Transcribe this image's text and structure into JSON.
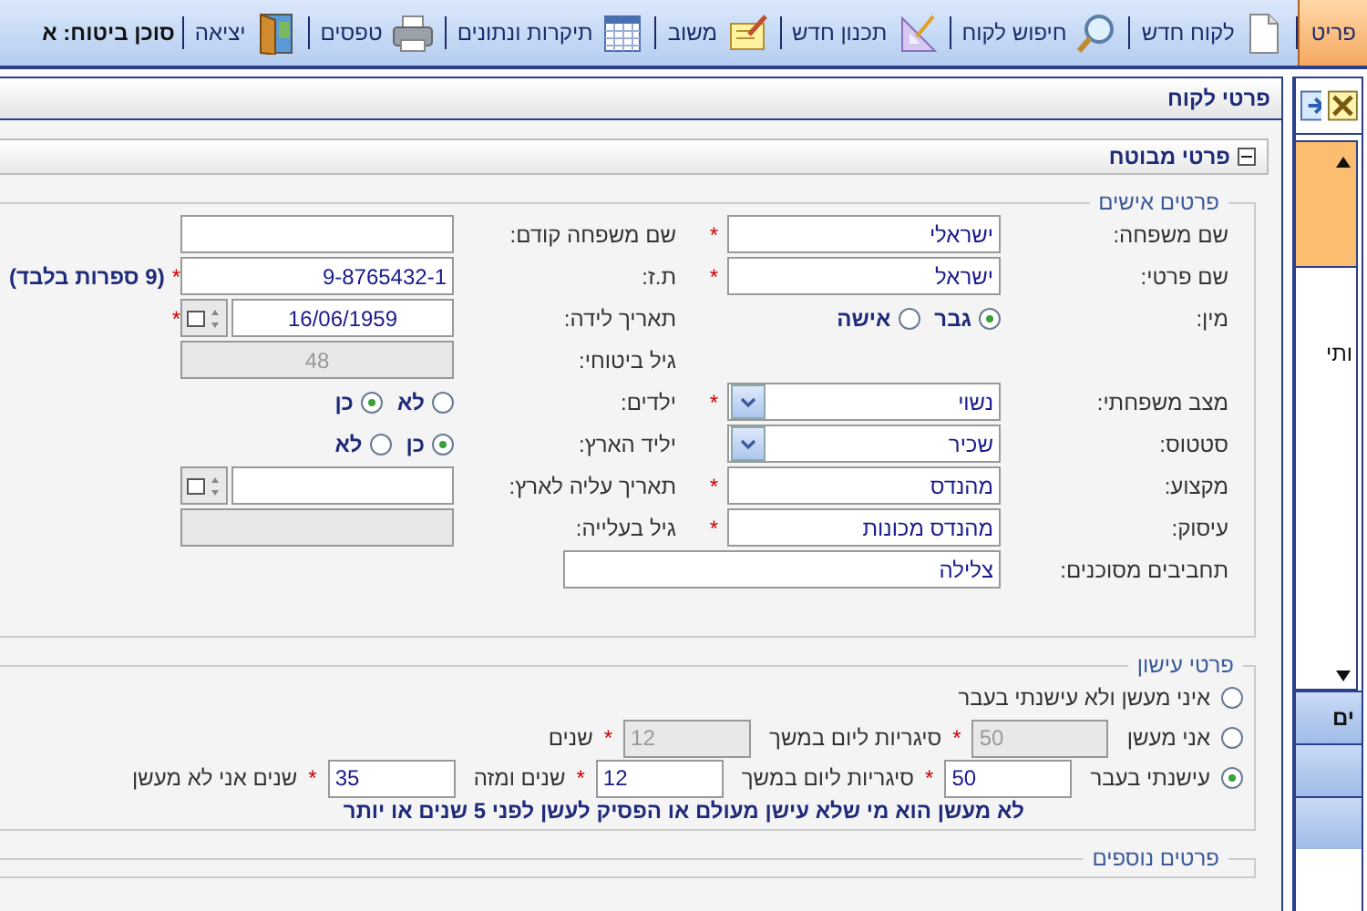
{
  "required_mark": "*",
  "toolbar": {
    "items": [
      {
        "label": "פריט",
        "selected": true
      },
      {
        "label": "לקוח חדש",
        "selected": false
      },
      {
        "label": "חיפוש לקוח",
        "selected": false
      },
      {
        "label": "תכנון חדש",
        "selected": false
      },
      {
        "label": "משוב",
        "selected": false
      },
      {
        "label": "תיקרות ונתונים",
        "selected": false
      },
      {
        "label": "טפסים",
        "selected": false
      },
      {
        "label": "יציאה",
        "selected": false
      }
    ],
    "agent_label": "סוכן ביטוח: א"
  },
  "panel": {
    "title": "פרטי לקוח",
    "section_title": "פרטי מבוטח",
    "section_expanded": true
  },
  "personal": {
    "legend": "פרטים אישים",
    "rows": [
      {
        "right": {
          "label": "שם משפחה:",
          "kind": "text",
          "value": "ישראלי",
          "required": true
        },
        "left": {
          "label": "שם משפחה קודם:",
          "kind": "text"
        }
      },
      {
        "right": {
          "label": "שם פרטי:",
          "kind": "text",
          "value": "ישראל",
          "required": true
        },
        "left": {
          "label": "ת.ז:",
          "kind": "text",
          "value": "9-8765432-1",
          "required": true,
          "note": "(9 ספרות בלבד)"
        }
      },
      {
        "right": {
          "label": "מין:",
          "kind": "radio",
          "options": [
            {
              "label": "גבר",
              "selected": true
            },
            {
              "label": "אישה",
              "selected": false
            }
          ]
        },
        "left": {
          "label": "תאריך לידה:",
          "kind": "date",
          "value": "16/06/1959",
          "required": true
        }
      },
      {
        "left": {
          "label": "גיל ביטוחי:",
          "kind": "text",
          "value": "48",
          "disabled": true
        }
      },
      {
        "right": {
          "label": "מצב משפחתי:",
          "kind": "select",
          "value": "נשוי",
          "required": true
        },
        "left": {
          "label": "ילדים:",
          "kind": "radio",
          "options": [
            {
              "label": "לא",
              "selected": false
            },
            {
              "label": "כן",
              "selected": true
            }
          ]
        }
      },
      {
        "right": {
          "label": "סטטוס:",
          "kind": "select",
          "value": "שכיר"
        },
        "left": {
          "label": "יליד הארץ:",
          "kind": "radio",
          "options": [
            {
              "label": "כן",
              "selected": true
            },
            {
              "label": "לא",
              "selected": false
            }
          ]
        }
      },
      {
        "right": {
          "label": "מקצוע:",
          "kind": "text",
          "value": "מהנדס",
          "required": true
        },
        "left": {
          "label": "תאריך עליה לארץ:",
          "kind": "date"
        }
      },
      {
        "right": {
          "label": "עיסוק:",
          "kind": "text",
          "value": "מהנדס מכונות",
          "required": true
        },
        "left": {
          "label": "גיל בעלייה:",
          "kind": "text",
          "disabled": true
        }
      },
      {
        "right": {
          "label": "תחביבים מסוכנים:",
          "kind": "wide",
          "value": "צלילה"
        }
      }
    ]
  },
  "smoking": {
    "legend": "פרטי עישון",
    "options": [
      {
        "selected": false,
        "parts": [
          {
            "kind": "text",
            "text": "איני מעשן ולא עישנתי בעבר"
          }
        ]
      },
      {
        "selected": false,
        "parts": [
          {
            "kind": "text",
            "text": "אני מעשן"
          },
          {
            "kind": "field",
            "value": "50",
            "disabled": true,
            "required": true
          },
          {
            "kind": "text",
            "text": "סיגריות ליום במשך"
          },
          {
            "kind": "field",
            "value": "12",
            "disabled": true,
            "required": true
          },
          {
            "kind": "text",
            "text": "שנים"
          }
        ]
      },
      {
        "selected": true,
        "parts": [
          {
            "kind": "text",
            "text": "עישנתי בעבר"
          },
          {
            "kind": "field",
            "value": "50",
            "disabled": false,
            "required": true
          },
          {
            "kind": "text",
            "text": "סיגריות ליום במשך"
          },
          {
            "kind": "field",
            "value": "12",
            "disabled": false,
            "required": true
          },
          {
            "kind": "text",
            "text": "שנים ומזה"
          },
          {
            "kind": "field",
            "value": "35",
            "disabled": false,
            "required": true
          },
          {
            "kind": "text",
            "text": "שנים אני לא מעשן"
          }
        ]
      }
    ],
    "note": "לא מעשן הוא מי שלא עישן מעולם או הפסיק לעשן לפני 5 שנים או יותר"
  },
  "more": {
    "legend": "פרטים נוספים"
  },
  "side_panel": {
    "partial_text": "ותי",
    "buttons": [
      {
        "label": "ים"
      }
    ]
  }
}
